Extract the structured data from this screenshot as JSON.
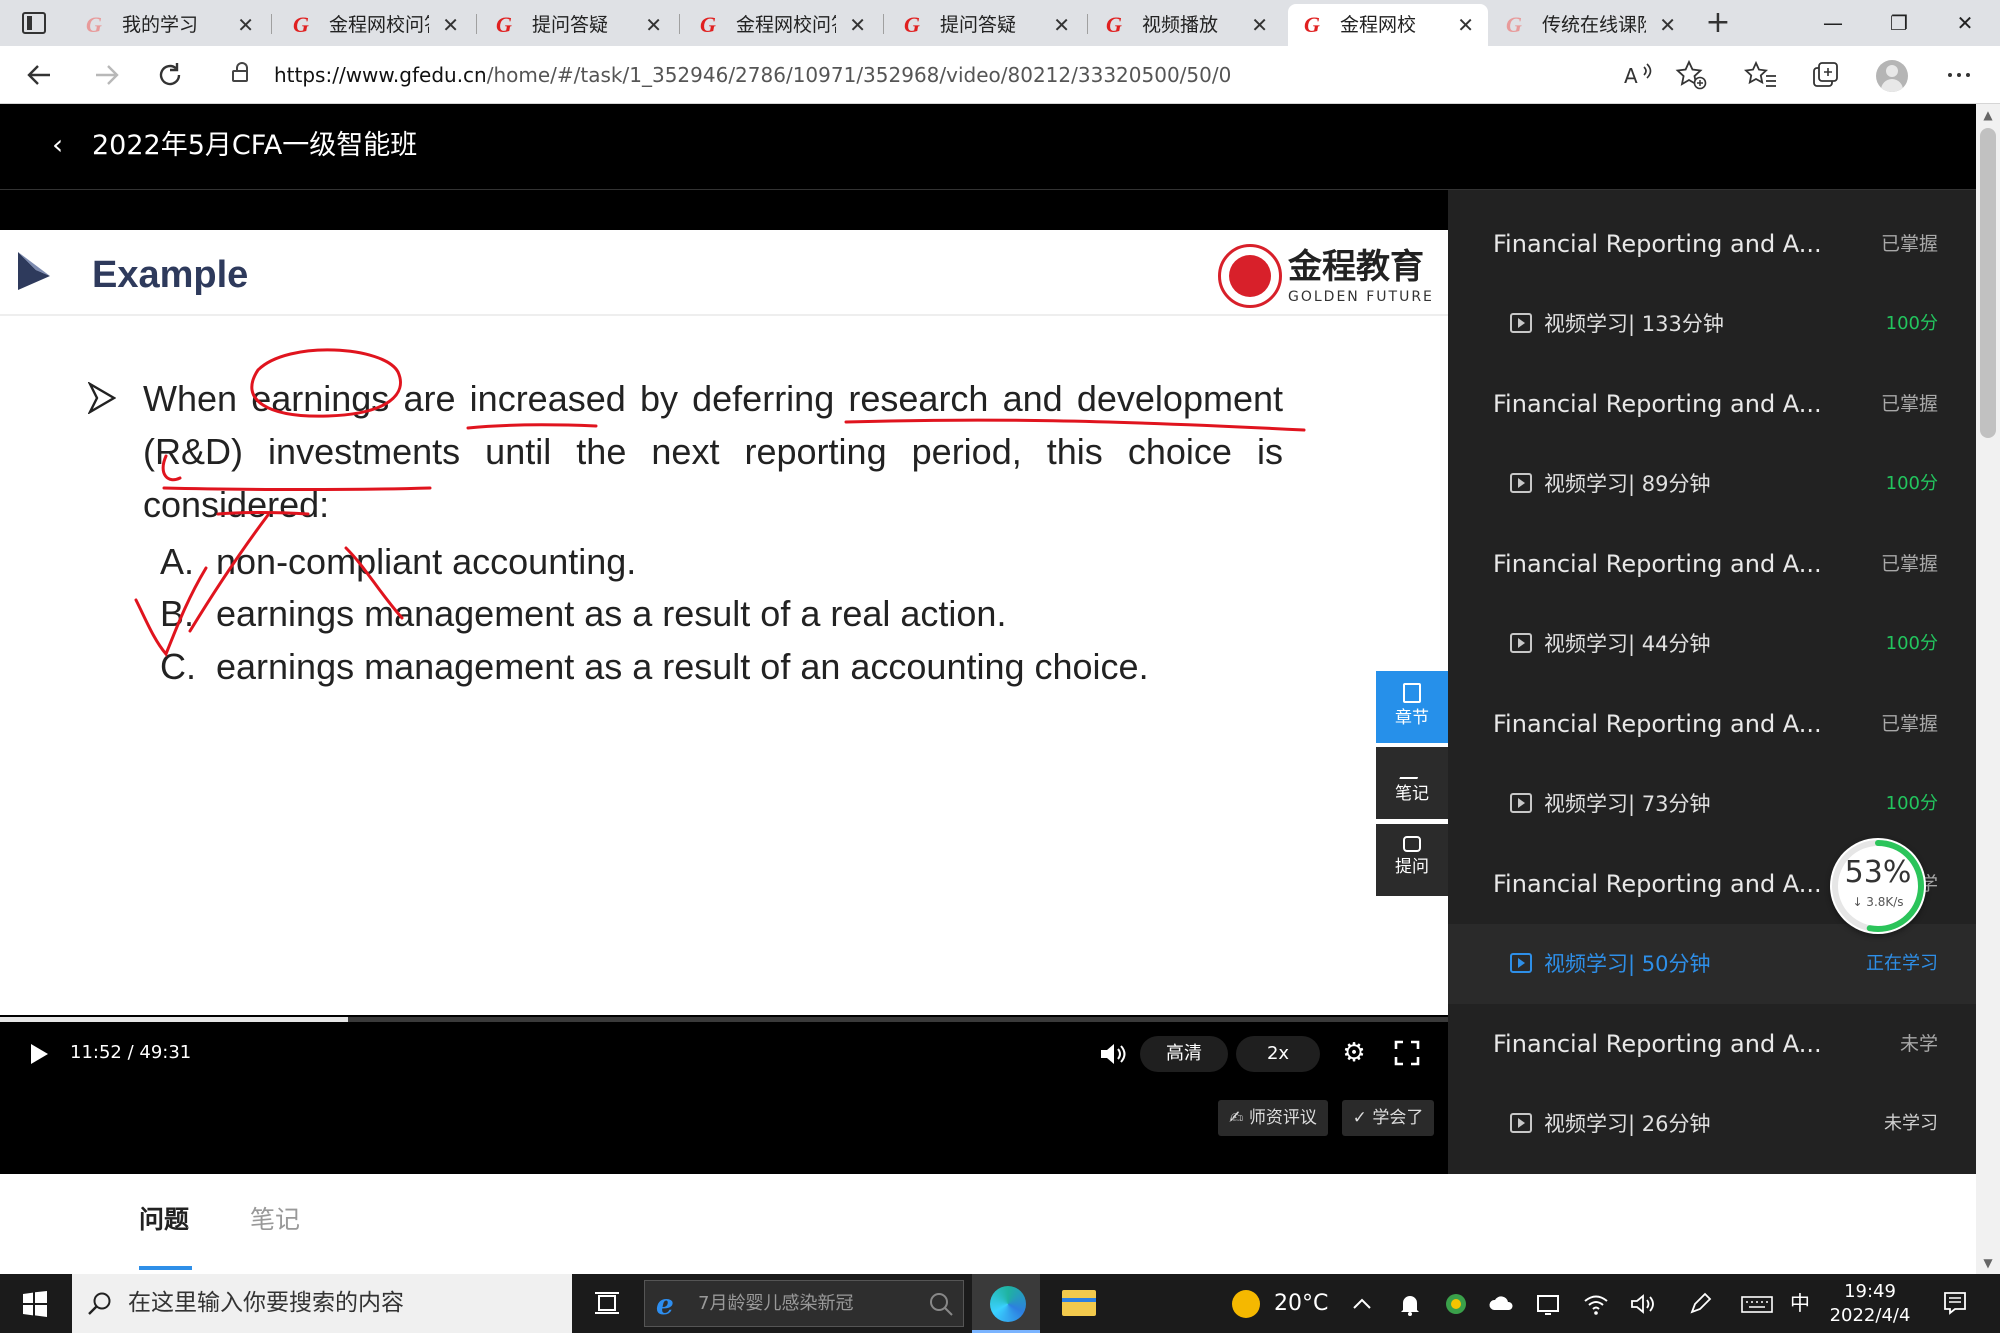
{
  "browser": {
    "tabs": [
      {
        "title": "我的学习",
        "active": false,
        "faded": true
      },
      {
        "title": "金程网校问答",
        "active": false,
        "faded": false
      },
      {
        "title": "提问答疑",
        "active": false,
        "faded": false
      },
      {
        "title": "金程网校问答",
        "active": false,
        "faded": false
      },
      {
        "title": "提问答疑",
        "active": false,
        "faded": false
      },
      {
        "title": "视频播放",
        "active": false,
        "faded": false
      },
      {
        "title": "金程网校",
        "active": true,
        "faded": false
      },
      {
        "title": "传统在线课阶",
        "active": false,
        "faded": true
      }
    ],
    "tab_close_glyph": "✕",
    "new_tab_glyph": "+",
    "window_controls": {
      "minimize": "—",
      "maximize": "❐",
      "close": "✕"
    },
    "url_host": "https://www.gfedu.cn",
    "url_path": "/home/#/task/1_352946/2786/10971/352968/video/80212/33320500/50/0",
    "icons": {
      "back": "back-arrow-icon",
      "forward": "forward-arrow-icon",
      "reload": "reload-icon"
    }
  },
  "page": {
    "course_title": "2022年5月CFA一级智能班",
    "back_glyph": "‹"
  },
  "slide": {
    "heading": "Example",
    "brand_name": "金程教育",
    "brand_sub": "GOLDEN FUTURE",
    "question": "When earnings are increased by deferring research and development (R&D) investments until the next reporting period, this choice is considered:",
    "options": [
      {
        "letter": "A.",
        "text": "non-compliant accounting."
      },
      {
        "letter": "B.",
        "text": "earnings management as a result of a real action."
      },
      {
        "letter": "C.",
        "text": "earnings management as a result of an accounting choice."
      }
    ]
  },
  "side_tools": [
    {
      "label": "章节",
      "active": true
    },
    {
      "label": "笔记",
      "active": false
    },
    {
      "label": "提问",
      "active": false
    }
  ],
  "player": {
    "time": "11:52 / 49:31",
    "progress_fraction": 0.24,
    "quality_label": "高清",
    "speed_label": "2x",
    "teacher_review_label": "✍ 师资评议",
    "learned_label": "✓ 学会了"
  },
  "chapters": [
    {
      "title": "Financial Reporting and A...",
      "status": "已掌握",
      "video": "视频学习| 133分钟",
      "score": "100分"
    },
    {
      "title": "Financial Reporting and A...",
      "status": "已掌握",
      "video": "视频学习| 89分钟",
      "score": "100分"
    },
    {
      "title": "Financial Reporting and A...",
      "status": "已掌握",
      "video": "视频学习| 44分钟",
      "score": "100分"
    },
    {
      "title": "Financial Reporting and A...",
      "status": "已掌握",
      "video": "视频学习| 73分钟",
      "score": "100分"
    },
    {
      "title": "Financial Reporting and A...",
      "status": "未学",
      "video": "视频学习| 50分钟",
      "score": "正在学习",
      "current": true
    },
    {
      "title": "Financial Reporting and A...",
      "status": "未学",
      "video": "视频学习| 26分钟",
      "score": "未学习",
      "grey": true
    }
  ],
  "speed_widget": {
    "percent": "53%",
    "rate": "↓ 3.8K/s"
  },
  "below_tabs": [
    {
      "label": "问题",
      "active": true
    },
    {
      "label": "笔记",
      "active": false
    }
  ],
  "taskbar": {
    "search_placeholder": "在这里输入你要搜索的内容",
    "ie_text": "7月龄婴儿感染新冠",
    "weather": "20°C",
    "ime": "中",
    "time": "19:49",
    "date": "2022/4/4"
  }
}
